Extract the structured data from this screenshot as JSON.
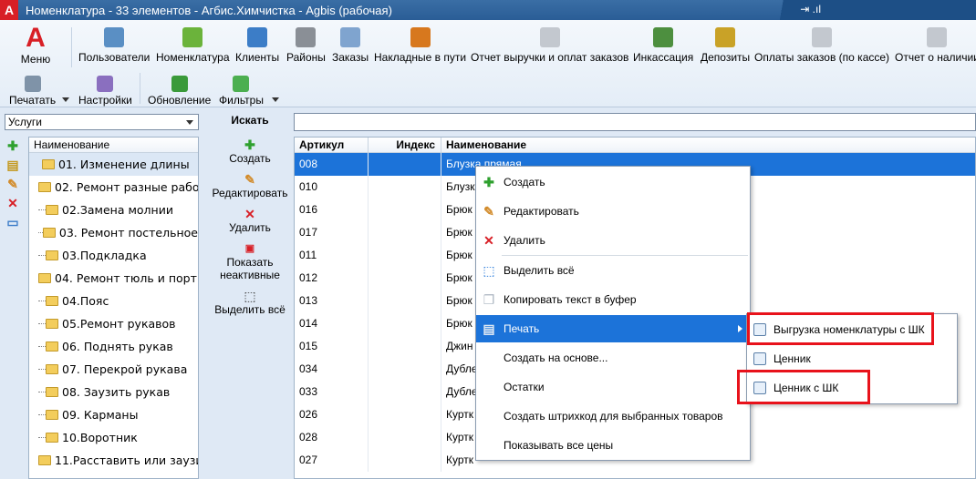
{
  "window": {
    "title": "Номенклатура - 33 элементов - Агбис.Химчистка - Agbis (рабочая)",
    "logo_letter": "A"
  },
  "tray": {
    "glyph": "⇥ .ıl"
  },
  "ribbon": {
    "menu_label": "Меню",
    "top_items": [
      {
        "label": "Пользователи",
        "icon": "users-icon",
        "color": "#5a8fc4"
      },
      {
        "label": "Номенклатура",
        "icon": "basket-icon",
        "color": "#6bb33b"
      },
      {
        "label": "Клиенты",
        "icon": "person-icon",
        "color": "#3c7dc7"
      },
      {
        "label": "Районы",
        "icon": "buildings-icon",
        "color": "#8a8f96"
      },
      {
        "label": "Заказы",
        "icon": "document-icon",
        "color": "#7fa4cf"
      },
      {
        "label": "Накладные в пути",
        "icon": "truck-icon",
        "color": "#d7781e"
      },
      {
        "label": "Отчет выручки и оплат заказов",
        "icon": "report-icon",
        "color": "#c3c8cf"
      },
      {
        "label": "Инкассация",
        "icon": "money-icon",
        "color": "#4d8f3f"
      },
      {
        "label": "Депозиты",
        "icon": "deposit-icon",
        "color": "#c9a227"
      },
      {
        "label": "Оплаты заказов (по кассе)",
        "icon": "report-icon",
        "color": "#c3c8cf"
      },
      {
        "label": "Отчет о наличии",
        "icon": "report-icon",
        "color": "#c3c8cf"
      }
    ],
    "bottom_items": [
      {
        "label": "Печатать",
        "icon": "printer-icon",
        "color": "#7f93a8"
      },
      {
        "label": "Настройки",
        "icon": "settings-icon",
        "color": "#8a6fbf"
      },
      {
        "label": "Обновление",
        "icon": "refresh-icon",
        "color": "#3a9a3a"
      },
      {
        "label": "Фильтры",
        "icon": "filter-icon",
        "color": "#4caf50"
      }
    ]
  },
  "left": {
    "category_select": "Услуги",
    "tree_header": "Наименование",
    "tree_items": [
      "01. Изменение длины",
      "02. Ремонт разные рабо",
      "02.Замена молнии",
      "03. Ремонт постельное",
      "03.Подкладка",
      "04. Ремонт тюль и порти",
      "04.Пояс",
      "05.Ремонт рукавов",
      "06. Поднять рукав",
      "07. Перекрой рукава",
      "08. Заузить рукав",
      "09. Карманы",
      "10.Воротник",
      "11.Расставить или заузи"
    ]
  },
  "actions": {
    "search_label": "Искать",
    "create": "Создать",
    "edit": "Редактировать",
    "delete": "Удалить",
    "show_inactive": "Показать неактивные",
    "select_all": "Выделить всё"
  },
  "grid": {
    "columns": [
      "Артикул",
      "Индекс",
      "Наименование"
    ],
    "rows": [
      [
        "008",
        "",
        "Блузка прямая"
      ],
      [
        "010",
        "",
        "Блузк"
      ],
      [
        "016",
        "",
        "Брюк"
      ],
      [
        "017",
        "",
        "Брюк"
      ],
      [
        "011",
        "",
        "Брюк"
      ],
      [
        "012",
        "",
        "Брюк"
      ],
      [
        "013",
        "",
        "Брюк"
      ],
      [
        "014",
        "",
        "Брюк"
      ],
      [
        "015",
        "",
        "Джин"
      ],
      [
        "034",
        "",
        "Дубле"
      ],
      [
        "033",
        "",
        "Дубле"
      ],
      [
        "026",
        "",
        "Куртк"
      ],
      [
        "028",
        "",
        "Куртк"
      ],
      [
        "027",
        "",
        "Куртк"
      ]
    ]
  },
  "context_menu": {
    "items": [
      {
        "label": "Создать",
        "icon": "plus-icon"
      },
      {
        "label": "Редактировать",
        "icon": "pencil-icon"
      },
      {
        "label": "Удалить",
        "icon": "delete-icon"
      },
      {
        "label": "Выделить всё",
        "icon": "select-all-icon"
      },
      {
        "label": "Копировать текст в буфер",
        "icon": "copy-icon"
      },
      {
        "label": "Печать",
        "icon": "printer-icon"
      },
      {
        "label": "Создать на основе...",
        "icon": ""
      },
      {
        "label": "Остатки",
        "icon": ""
      },
      {
        "label": "Создать штрихкод для выбранных товаров",
        "icon": ""
      },
      {
        "label": "Показывать все цены",
        "icon": ""
      }
    ],
    "submenu": [
      "Выгрузка номенклатуры с ШК",
      "Ценник",
      "Ценник с ШК"
    ]
  }
}
